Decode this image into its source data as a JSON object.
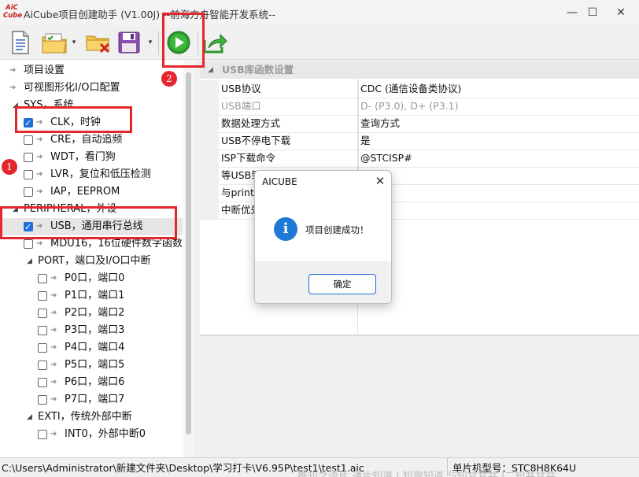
{
  "window": {
    "title": "AiCube项目创建助手 (V1.00J) --前海方舟智能开发系统--",
    "logo_text": "AiCCube",
    "minimize": "—",
    "maximize": "☐",
    "close": "✕"
  },
  "toolbar": {
    "buttons": [
      {
        "name": "new-document-icon"
      },
      {
        "name": "open-checklist-icon"
      },
      {
        "name": "delete-folder-icon"
      },
      {
        "name": "save-disk-icon"
      },
      {
        "name": "run-play-icon"
      },
      {
        "name": "export-arrow-icon"
      }
    ],
    "dropdown": "▾"
  },
  "tree": [
    {
      "label": "项目设置",
      "level": 0,
      "kind": "arrow"
    },
    {
      "label": "可视图形化I/O口配置",
      "level": 0,
      "kind": "arrow"
    },
    {
      "label": "SYS，系统",
      "level": 0,
      "kind": "group"
    },
    {
      "label": "CLK，时钟",
      "level": 1,
      "checked": true
    },
    {
      "label": "CRE，自动追频",
      "level": 1,
      "checked": false
    },
    {
      "label": "WDT，看门狗",
      "level": 1,
      "checked": false
    },
    {
      "label": "LVR，复位和低压检测",
      "level": 1,
      "checked": false
    },
    {
      "label": "IAP，EEPROM",
      "level": 1,
      "checked": false
    },
    {
      "label": "PERIPHERAL，外设",
      "level": 0,
      "kind": "group"
    },
    {
      "label": "USB，通用串行总线",
      "level": 1,
      "checked": true
    },
    {
      "label": "MDU16，16位硬件数字函数",
      "level": 1,
      "checked": false
    },
    {
      "label": "PORT，端口及I/O口中断",
      "level": 1,
      "kind": "group"
    },
    {
      "label": "P0口，端口0",
      "level": 2,
      "checked": false
    },
    {
      "label": "P1口，端口1",
      "level": 2,
      "checked": false
    },
    {
      "label": "P2口，端口2",
      "level": 2,
      "checked": false
    },
    {
      "label": "P3口，端口3",
      "level": 2,
      "checked": false
    },
    {
      "label": "P4口，端口4",
      "level": 2,
      "checked": false
    },
    {
      "label": "P5口，端口5",
      "level": 2,
      "checked": false
    },
    {
      "label": "P6口，端口6",
      "level": 2,
      "checked": false
    },
    {
      "label": "P7口，端口7",
      "level": 2,
      "checked": false
    },
    {
      "label": "EXTI，传统外部中断",
      "level": 1,
      "kind": "group"
    },
    {
      "label": "INT0，外部中断0",
      "level": 2,
      "checked": false
    }
  ],
  "props": {
    "header": "USB库函数设置",
    "rows": [
      {
        "name": "USB协议",
        "value": "CDC (通信设备类协议)",
        "dim": false
      },
      {
        "name": "USB端口",
        "value": "D- (P3.0), D+ (P3.1)",
        "dim": true
      },
      {
        "name": "数据处理方式",
        "value": "查询方式",
        "dim": false
      },
      {
        "name": "USB不停电下载",
        "value": "是",
        "dim": false
      },
      {
        "name": "ISP下载命令",
        "value": "@STCISP#",
        "dim": false
      },
      {
        "name": "等USB到",
        "value": "",
        "dim": false
      },
      {
        "name": "与printf",
        "value": "",
        "dim": false
      },
      {
        "name": "中断优先",
        "value": "先级",
        "dim": false
      }
    ]
  },
  "dialog": {
    "title": "AICUBE",
    "message": "项目创建成功！",
    "ok": "确定",
    "close": "✕",
    "icon": "i"
  },
  "annotations": {
    "badge1": "1",
    "badge2": "2"
  },
  "status": {
    "path": "C:\\Users\\Administrator\\新建文件夹\\Desktop\\学习打卡\\V6.95P\\test1\\test1.aic",
    "mcu": "单片机型号：STC8H8K64U"
  },
  "background_text": "推知之语片 通片知道 | 知曾知道 与知甘甘共 |二知共甘共"
}
